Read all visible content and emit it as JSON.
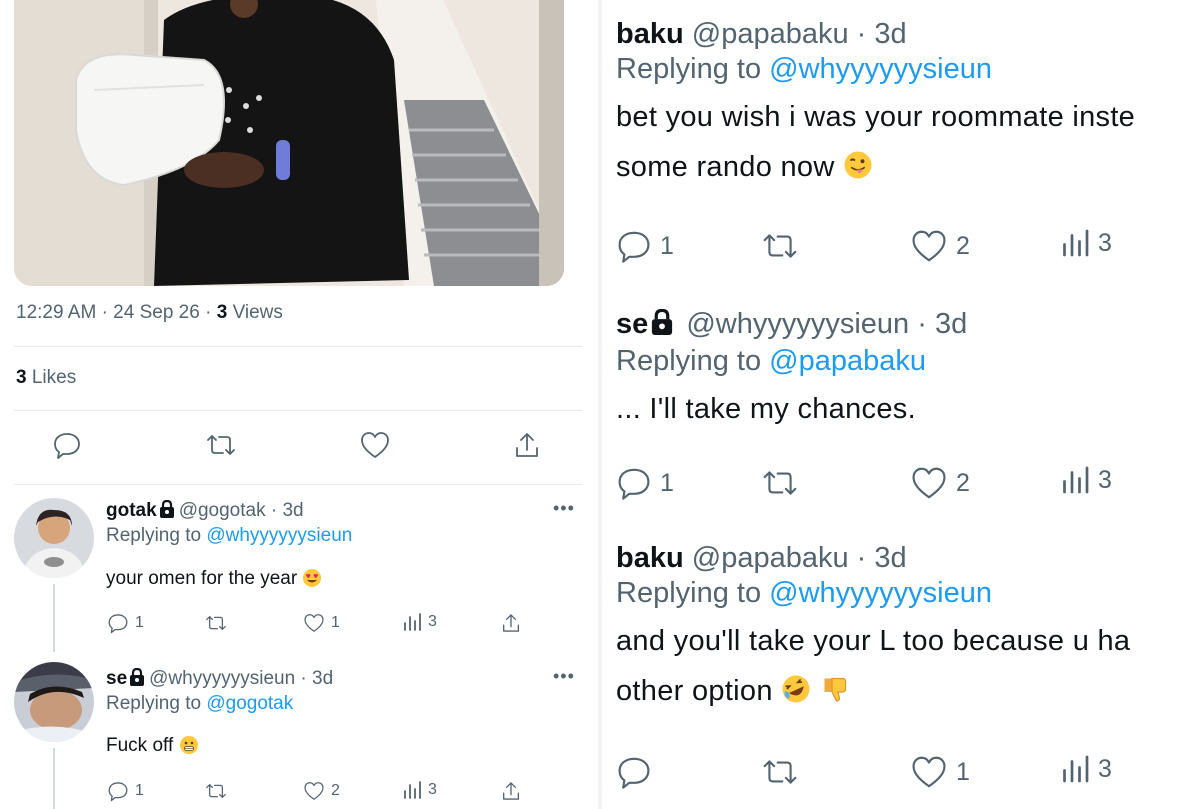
{
  "main_tweet": {
    "time": "12:29 AM",
    "date": "24 Sep 26",
    "views_count": "3",
    "views_label": "Views",
    "likes_count": "3",
    "likes_label": "Likes"
  },
  "left_replies": [
    {
      "name": "gotak",
      "handle": "@gogotak",
      "age": "3d",
      "replying_prefix": "Replying to",
      "replying_to": "@whyyyyyysieun",
      "text": "your omen for the year",
      "emoji": "heart-eyes",
      "replies": "1",
      "likes": "1",
      "views": "3",
      "more": "•••"
    },
    {
      "name": "se",
      "handle": "@whyyyyyysieun",
      "age": "3d",
      "replying_prefix": "Replying to",
      "replying_to": "@gogotak",
      "text": "Fuck off",
      "emoji": "grimace",
      "replies": "1",
      "likes": "2",
      "views": "3",
      "more": "•••"
    }
  ],
  "right_tweets": [
    {
      "name": "baku",
      "handle": "@papabaku",
      "age": "3d",
      "replying_prefix": "Replying to",
      "replying_to": "@whyyyyyysieun",
      "line1": "bet you wish i was your roommate inste",
      "line2": "some rando now",
      "emoji": "tongue-out",
      "replies": "1",
      "likes": "2",
      "views": "3"
    },
    {
      "name": "se",
      "handle": "@whyyyyyysieun",
      "age": "3d",
      "replying_prefix": "Replying to",
      "replying_to": "@papabaku",
      "line1": "... I'll take my chances.",
      "replies": "1",
      "likes": "2",
      "views": "3"
    },
    {
      "name": "baku",
      "handle": "@papabaku",
      "age": "3d",
      "replying_prefix": "Replying to",
      "replying_to": "@whyyyyyysieun",
      "line1": "and you'll take your L too because u ha",
      "line2": "other option",
      "emoji": "rolling-laughing",
      "emoji2": "thumbs-down",
      "replies": "",
      "likes": "1",
      "views": "3"
    }
  ],
  "separator": "·",
  "colors": {
    "mention": "#1d9bf0",
    "muted": "#536471",
    "text": "#0f1419"
  }
}
